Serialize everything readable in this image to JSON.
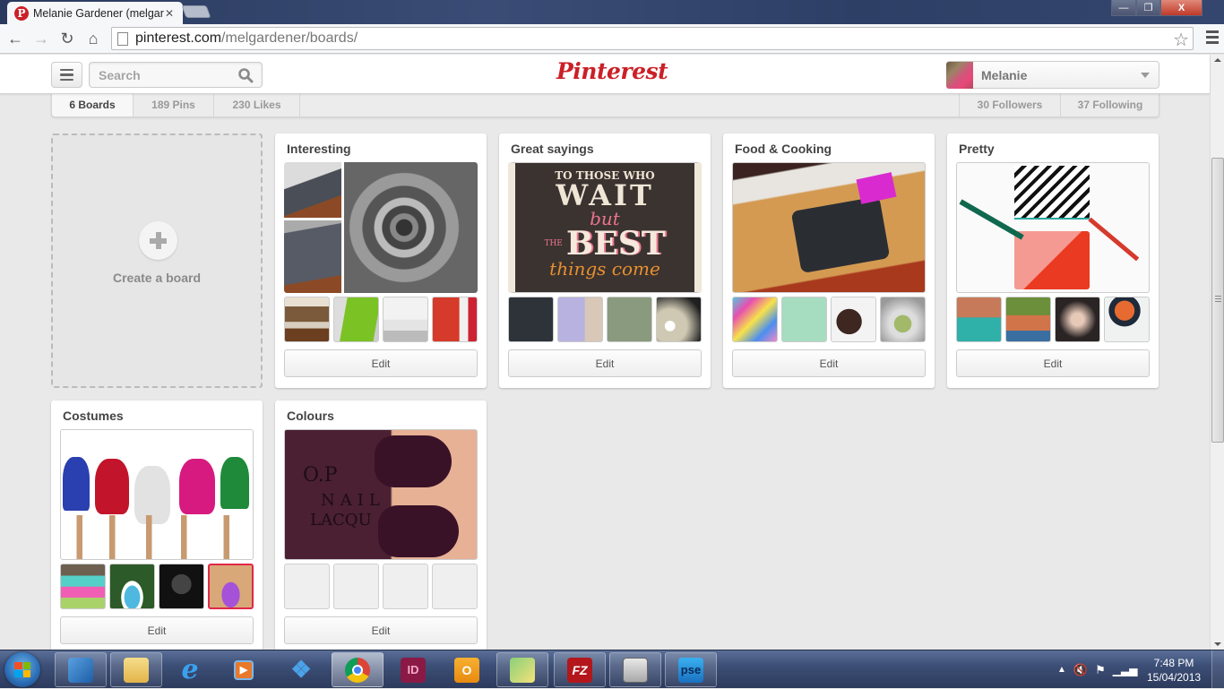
{
  "browser": {
    "tab_title": "Melanie Gardener (melgar",
    "url_host": "pinterest.com",
    "url_path": "/melgardener/boards/",
    "favicon_letter": "P",
    "window_controls": {
      "minimize": "—",
      "maximize": "❐",
      "close": "X"
    }
  },
  "header": {
    "logo": "Pinterest",
    "search_placeholder": "Search",
    "user_name": "Melanie",
    "brand_color": "#cb2027"
  },
  "stats": {
    "boards": "6 Boards",
    "pins": "189 Pins",
    "likes": "230 Likes",
    "followers": "30 Followers",
    "following": "37 Following"
  },
  "create_board": {
    "label": "Create a board"
  },
  "boards": [
    {
      "title": "Interesting",
      "edit_label": "Edit",
      "cover": "spiral-sink",
      "thumbs": [
        "bookshelf-room",
        "green-panel",
        "white-bathroom",
        "red-kitchen"
      ]
    },
    {
      "title": "Great sayings",
      "edit_label": "Edit",
      "cover": "good-things-come-to-those-who-wait-poster",
      "cover_text": [
        "TO THOSE WHO",
        "WAIT",
        "but",
        "THE",
        "BEST",
        "things come"
      ],
      "thumbs": [
        "chalkboard-quote",
        "retro-ecard",
        "best-of-everything-quote",
        "lightbulb-quote"
      ]
    },
    {
      "title": "Food & Cooking",
      "edit_label": "Edit",
      "cover": "number-cake-pan",
      "thumbs": [
        "rainbow-dough",
        "ecard-green",
        "chocolate-strawberries",
        "bowl-salad"
      ]
    },
    {
      "title": "Pretty",
      "edit_label": "Edit",
      "cover": "striped-clutch",
      "thumbs": [
        "coastal-village",
        "hillside-town",
        "umbrella-sky",
        "umbrella-man"
      ]
    },
    {
      "title": "Costumes",
      "edit_label": "Edit",
      "cover": "dance-costumes",
      "thumbs": [
        "tutu-rainbow",
        "alice-dress",
        "black-tutu",
        "purple-tutu"
      ]
    },
    {
      "title": "Colours",
      "edit_label": "Edit",
      "cover": "opi-nail-polish",
      "cover_text": [
        "O.P",
        "NAIL",
        "LACQU"
      ],
      "thumbs": []
    }
  ],
  "taskbar": {
    "apps": [
      "windows-explorer-libraries",
      "file-explorer",
      "internet-explorer",
      "media-player",
      "dropbox",
      "chrome",
      "indesign",
      "outlook",
      "sticky-notes",
      "filezilla",
      "calculator",
      "photoshop-elements"
    ],
    "indesign_label": "ID",
    "filezilla_label": "FZ",
    "pse_label": "pse",
    "time": "7:48 PM",
    "date": "15/04/2013"
  }
}
